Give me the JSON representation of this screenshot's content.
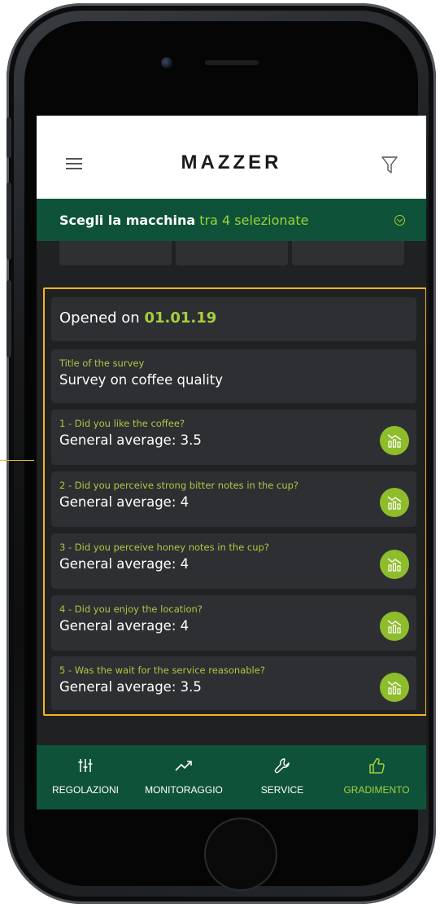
{
  "header": {
    "brand": "MAZZER",
    "menu_icon": "hamburger-menu-icon",
    "filter_icon": "filter-icon"
  },
  "machine_selector": {
    "label": "Scegli la macchina",
    "suffix": "tra 4 selezionate",
    "icon": "chevron-circle-down-icon"
  },
  "survey": {
    "opened_prefix": "Opened on",
    "opened_date": "01.01.19",
    "title_label": "Title of the survey",
    "title_value": "Survey on coffee quality",
    "questions": [
      {
        "label": "1 - Did you like the coffee?",
        "value": "General average: 3.5",
        "icon": "chart-icon"
      },
      {
        "label": "2 - Did you perceive strong bitter notes in the cup?",
        "value": "General average: 4",
        "icon": "chart-icon"
      },
      {
        "label": "3 - Did you perceive honey notes in the cup?",
        "value": "General average: 4",
        "icon": "chart-icon"
      },
      {
        "label": "4 -  Did you enjoy the location?",
        "value": "General average: 4",
        "icon": "chart-icon"
      },
      {
        "label": "5 - Was the wait for the service reasonable?",
        "value": "General average: 3.5",
        "icon": "chart-icon"
      }
    ]
  },
  "bottom_nav": {
    "items": [
      {
        "label": "REGOLAZIONI",
        "icon": "sliders-icon",
        "active": false
      },
      {
        "label": "MONITORAGGIO",
        "icon": "trend-up-icon",
        "active": false
      },
      {
        "label": "SERVICE",
        "icon": "wrench-icon",
        "active": false
      },
      {
        "label": "GRADIMENTO",
        "icon": "thumbs-up-icon",
        "active": true
      }
    ]
  },
  "colors": {
    "brand_green": "#0e5239",
    "accent_lime": "#a7cf3d",
    "highlight": "#f4b620",
    "card_bg": "#2e2f32",
    "screen_bg": "#202123"
  }
}
